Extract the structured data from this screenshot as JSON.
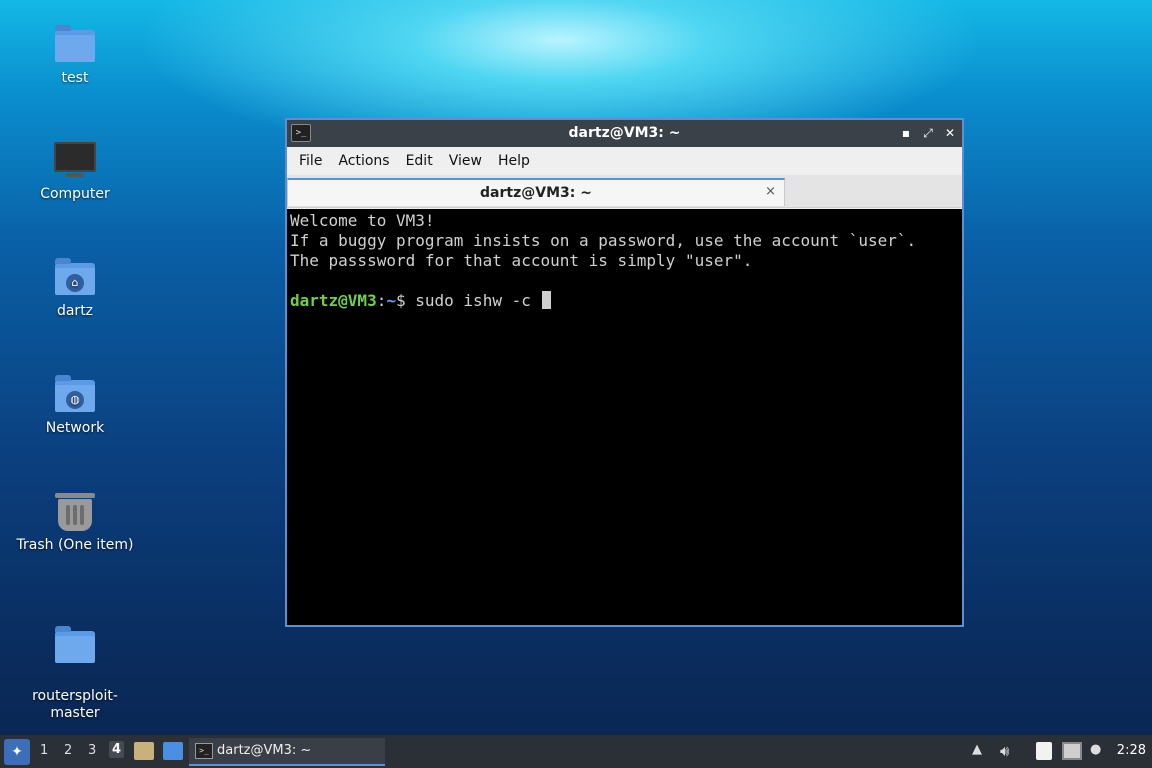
{
  "desktop": {
    "icons": [
      {
        "label": "test",
        "icon": "folder-icon"
      },
      {
        "label": "Computer",
        "icon": "computer-icon"
      },
      {
        "label": "dartz",
        "icon": "home-folder-icon"
      },
      {
        "label": "Network",
        "icon": "network-folder-icon"
      },
      {
        "label": "Trash (One item)",
        "icon": "trash-icon"
      },
      {
        "label": "routersploit-\nmaster",
        "icon": "folder-icon"
      }
    ]
  },
  "window": {
    "title": "dartz@VM3: ~",
    "controls": {
      "minimize": "▪",
      "maximize": "⤢",
      "close": "✕"
    },
    "app_icon_text": ">_"
  },
  "menubar": {
    "items": [
      "File",
      "Actions",
      "Edit",
      "View",
      "Help"
    ]
  },
  "tab": {
    "label": "dartz@VM3: ~",
    "close": "×"
  },
  "terminal": {
    "lines": [
      "Welcome to VM3!",
      "If a buggy program insists on a password, use the account `user`.",
      "The passsword for that account is simply \"user\"."
    ],
    "prompt_user": "dartz@VM3",
    "prompt_sep": ":",
    "prompt_path": "~",
    "prompt_symbol": "$",
    "command": " sudo ishw -c "
  },
  "taskbar": {
    "workspaces": [
      "1",
      "2",
      "3",
      "4"
    ],
    "active_workspace": "4",
    "task_label": "dartz@VM3: ~",
    "clock": "2:28"
  }
}
